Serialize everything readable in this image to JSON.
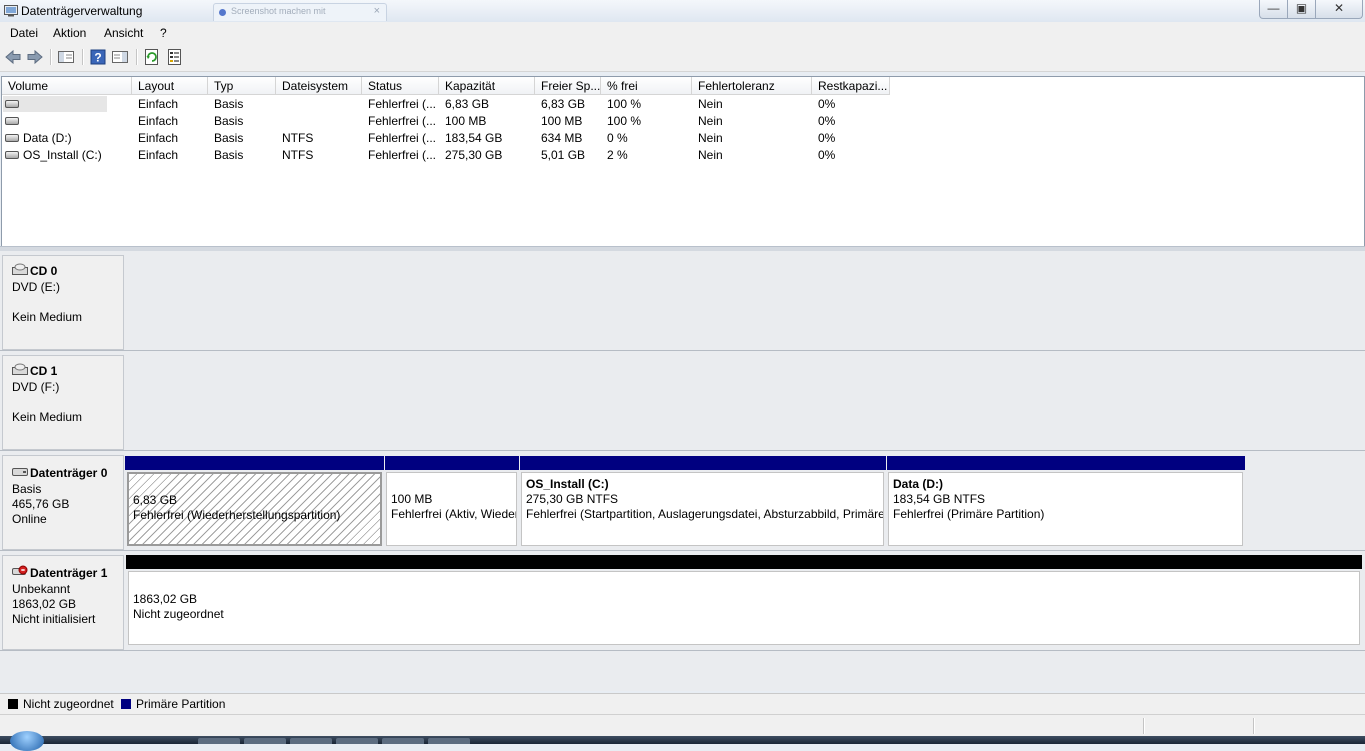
{
  "window": {
    "title": "Datenträgerverwaltung",
    "background_tab": "Screenshot machen mit",
    "background_tab_close": "×",
    "buttons": {
      "minimize": "—",
      "maximize": "▣",
      "close": "✕"
    }
  },
  "menu": [
    "Datei",
    "Aktion",
    "Ansicht",
    "?"
  ],
  "volume_list": {
    "columns": [
      "Volume",
      "Layout",
      "Typ",
      "Dateisystem",
      "Status",
      "Kapazität",
      "Freier Sp...",
      "% frei",
      "Fehlertoleranz",
      "Restkapazi..."
    ],
    "rows": [
      {
        "volume": "",
        "layout": "Einfach",
        "typ": "Basis",
        "fs": "",
        "status": "Fehlerfrei (...",
        "capacity": "6,83 GB",
        "free": "6,83 GB",
        "pct": "100 %",
        "fault": "Nein",
        "rest": "0%"
      },
      {
        "volume": "",
        "layout": "Einfach",
        "typ": "Basis",
        "fs": "",
        "status": "Fehlerfrei (...",
        "capacity": "100 MB",
        "free": "100 MB",
        "pct": "100 %",
        "fault": "Nein",
        "rest": "0%"
      },
      {
        "volume": "Data (D:)",
        "layout": "Einfach",
        "typ": "Basis",
        "fs": "NTFS",
        "status": "Fehlerfrei (...",
        "capacity": "183,54 GB",
        "free": "634 MB",
        "pct": "0 %",
        "fault": "Nein",
        "rest": "0%"
      },
      {
        "volume": "OS_Install (C:)",
        "layout": "Einfach",
        "typ": "Basis",
        "fs": "NTFS",
        "status": "Fehlerfrei (...",
        "capacity": "275,30 GB",
        "free": "5,01 GB",
        "pct": "2 %",
        "fault": "Nein",
        "rest": "0%"
      }
    ]
  },
  "disks": {
    "cd0": {
      "name": "CD 0",
      "line1": "DVD (E:)",
      "line3": "Kein Medium"
    },
    "cd1": {
      "name": "CD 1",
      "line1": "DVD (F:)",
      "line3": "Kein Medium"
    },
    "disk0": {
      "name": "Datenträger 0",
      "type": "Basis",
      "size": "465,76 GB",
      "state": "Online",
      "partitions": [
        {
          "title": "",
          "size": "6,83 GB",
          "status": "Fehlerfrei (Wiederherstellungspartition)"
        },
        {
          "title": "",
          "size": "100 MB",
          "status": "Fehlerfrei (Aktiv, Wiederherstellungspartition)"
        },
        {
          "title": "OS_Install  (C:)",
          "size": "275,30 GB NTFS",
          "status": "Fehlerfrei (Startpartition, Auslagerungsdatei, Absturzabbild, Primäre Partition)"
        },
        {
          "title": "Data  (D:)",
          "size": "183,54 GB NTFS",
          "status": "Fehlerfrei (Primäre Partition)"
        }
      ]
    },
    "disk1": {
      "name": "Datenträger 1",
      "type": "Unbekannt",
      "size": "1863,02 GB",
      "state": "Nicht initialisiert",
      "partition": {
        "size": "1863,02 GB",
        "status": "Nicht zugeordnet"
      }
    }
  },
  "legend": {
    "unallocated": {
      "label": "Nicht zugeordnet",
      "color": "#000000"
    },
    "primary": {
      "label": "Primäre Partition",
      "color": "#000080"
    }
  },
  "colors": {
    "primary_bar": "#000080",
    "unallocated_bar": "#000000"
  },
  "icons": [
    "management-console-icon",
    "back-arrow-icon",
    "forward-arrow-icon",
    "console-tree-icon",
    "help-icon",
    "action-pane-icon",
    "refresh-icon",
    "properties-icon",
    "disk-drive-icon",
    "cd-drive-icon",
    "disk-error-icon"
  ]
}
